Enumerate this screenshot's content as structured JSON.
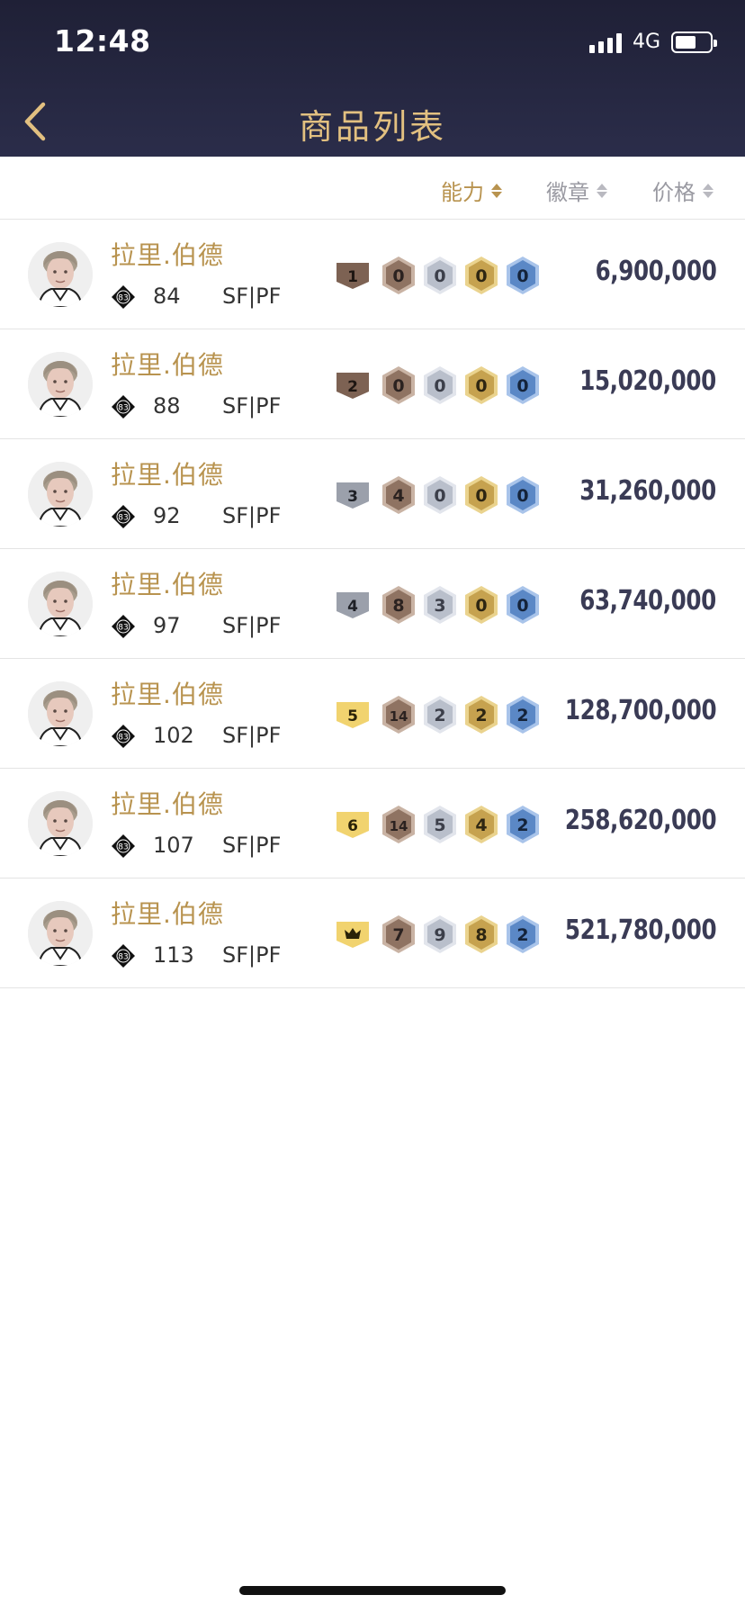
{
  "status_bar": {
    "time": "12:48",
    "network": "4G"
  },
  "header": {
    "title": "商品列表"
  },
  "sort_bar": {
    "ability": "能力",
    "badge": "徽章",
    "price": "价格"
  },
  "colors": {
    "header_bg": "#1f2036",
    "gold_text": "#b8934f",
    "title_gold": "#e2c080",
    "price_text": "#3a3b55",
    "bronze": "#8a6e5c",
    "silver": "#b7bcc8",
    "gold": "#caa550",
    "blue": "#5a86c4",
    "level_brown": "#7d6253",
    "level_gray": "#9ba0ab",
    "level_yellow": "#f1d36f"
  },
  "items": [
    {
      "name": "拉里.伯德",
      "rating": "84",
      "position": "SF|PF",
      "overall_icon": "83",
      "level": "1",
      "level_color": "brown",
      "badges": [
        "0",
        "0",
        "0",
        "0"
      ],
      "price": "6,900,000"
    },
    {
      "name": "拉里.伯德",
      "rating": "88",
      "position": "SF|PF",
      "overall_icon": "83",
      "level": "2",
      "level_color": "brown",
      "badges": [
        "0",
        "0",
        "0",
        "0"
      ],
      "price": "15,020,000"
    },
    {
      "name": "拉里.伯德",
      "rating": "92",
      "position": "SF|PF",
      "overall_icon": "83",
      "level": "3",
      "level_color": "gray",
      "badges": [
        "4",
        "0",
        "0",
        "0"
      ],
      "price": "31,260,000"
    },
    {
      "name": "拉里.伯德",
      "rating": "97",
      "position": "SF|PF",
      "overall_icon": "83",
      "level": "4",
      "level_color": "gray",
      "badges": [
        "8",
        "3",
        "0",
        "0"
      ],
      "price": "63,740,000"
    },
    {
      "name": "拉里.伯德",
      "rating": "102",
      "position": "SF|PF",
      "overall_icon": "83",
      "level": "5",
      "level_color": "yellow",
      "badges": [
        "14",
        "2",
        "2",
        "2"
      ],
      "price": "128,700,000"
    },
    {
      "name": "拉里.伯德",
      "rating": "107",
      "position": "SF|PF",
      "overall_icon": "83",
      "level": "6",
      "level_color": "yellow",
      "badges": [
        "14",
        "5",
        "4",
        "2"
      ],
      "price": "258,620,000"
    },
    {
      "name": "拉里.伯德",
      "rating": "113",
      "position": "SF|PF",
      "overall_icon": "83",
      "level": "crown-icon",
      "level_color": "yellow",
      "badges": [
        "7",
        "9",
        "8",
        "2"
      ],
      "price": "521,780,000"
    }
  ]
}
